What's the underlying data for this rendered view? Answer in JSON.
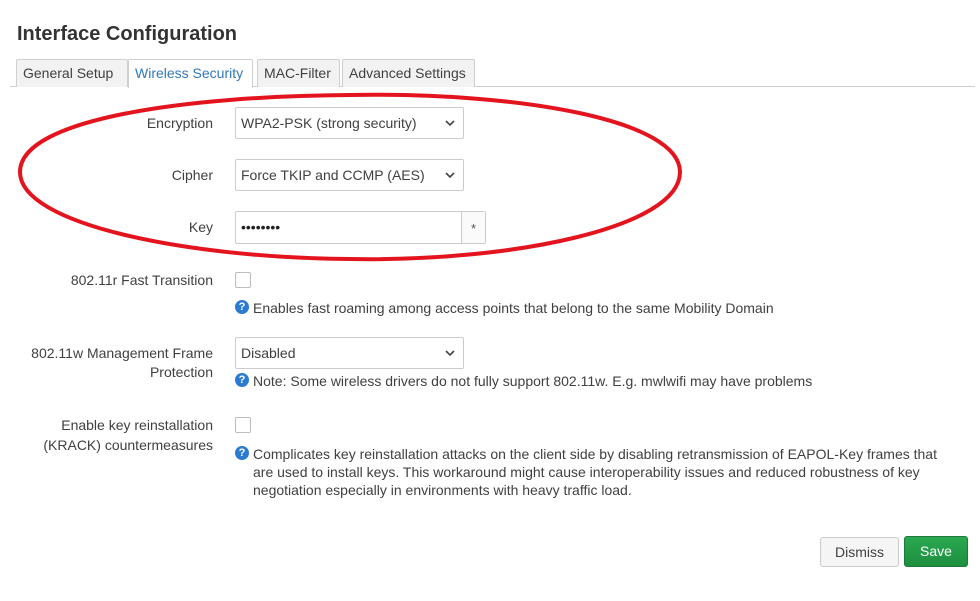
{
  "header": {
    "title": "Interface Configuration"
  },
  "tabs": [
    {
      "label": "General Setup"
    },
    {
      "label": "Wireless Security"
    },
    {
      "label": "MAC-Filter"
    },
    {
      "label": "Advanced Settings"
    }
  ],
  "form": {
    "encryption": {
      "label": "Encryption",
      "value": "WPA2-PSK (strong security)"
    },
    "cipher": {
      "label": "Cipher",
      "value": "Force TKIP and CCMP (AES)"
    },
    "key": {
      "label": "Key",
      "value": "••••••••",
      "reveal": "*"
    },
    "fast_transition": {
      "label": "802.11r Fast Transition",
      "checked": false,
      "help": "Enables fast roaming among access points that belong to the same Mobility Domain"
    },
    "mfp": {
      "label_line1": "802.11w Management Frame",
      "label_line2": "Protection",
      "value": "Disabled",
      "help": "Note: Some wireless drivers do not fully support 802.11w. E.g. mwlwifi may have problems"
    },
    "krack": {
      "label_line1": "Enable key reinstallation",
      "label_line2": "(KRACK) countermeasures",
      "checked": false,
      "help_line1": "Complicates key reinstallation attacks on the client side by disabling retransmission of EAPOL-Key frames that",
      "help_line2": "are used to install keys. This workaround might cause interoperability issues and reduced robustness of key",
      "help_line3": "negotiation especially in environments with heavy traffic load."
    }
  },
  "footer": {
    "dismiss_label": "Dismiss",
    "save_label": "Save"
  },
  "colors": {
    "accent": "#3178b8",
    "annotation": "#e3141e",
    "save_button": "#28a745",
    "help_icon": "#2d7bd0"
  },
  "icons": {
    "select_arrow": "chevron-down-icon",
    "help": "question-circle-icon"
  }
}
